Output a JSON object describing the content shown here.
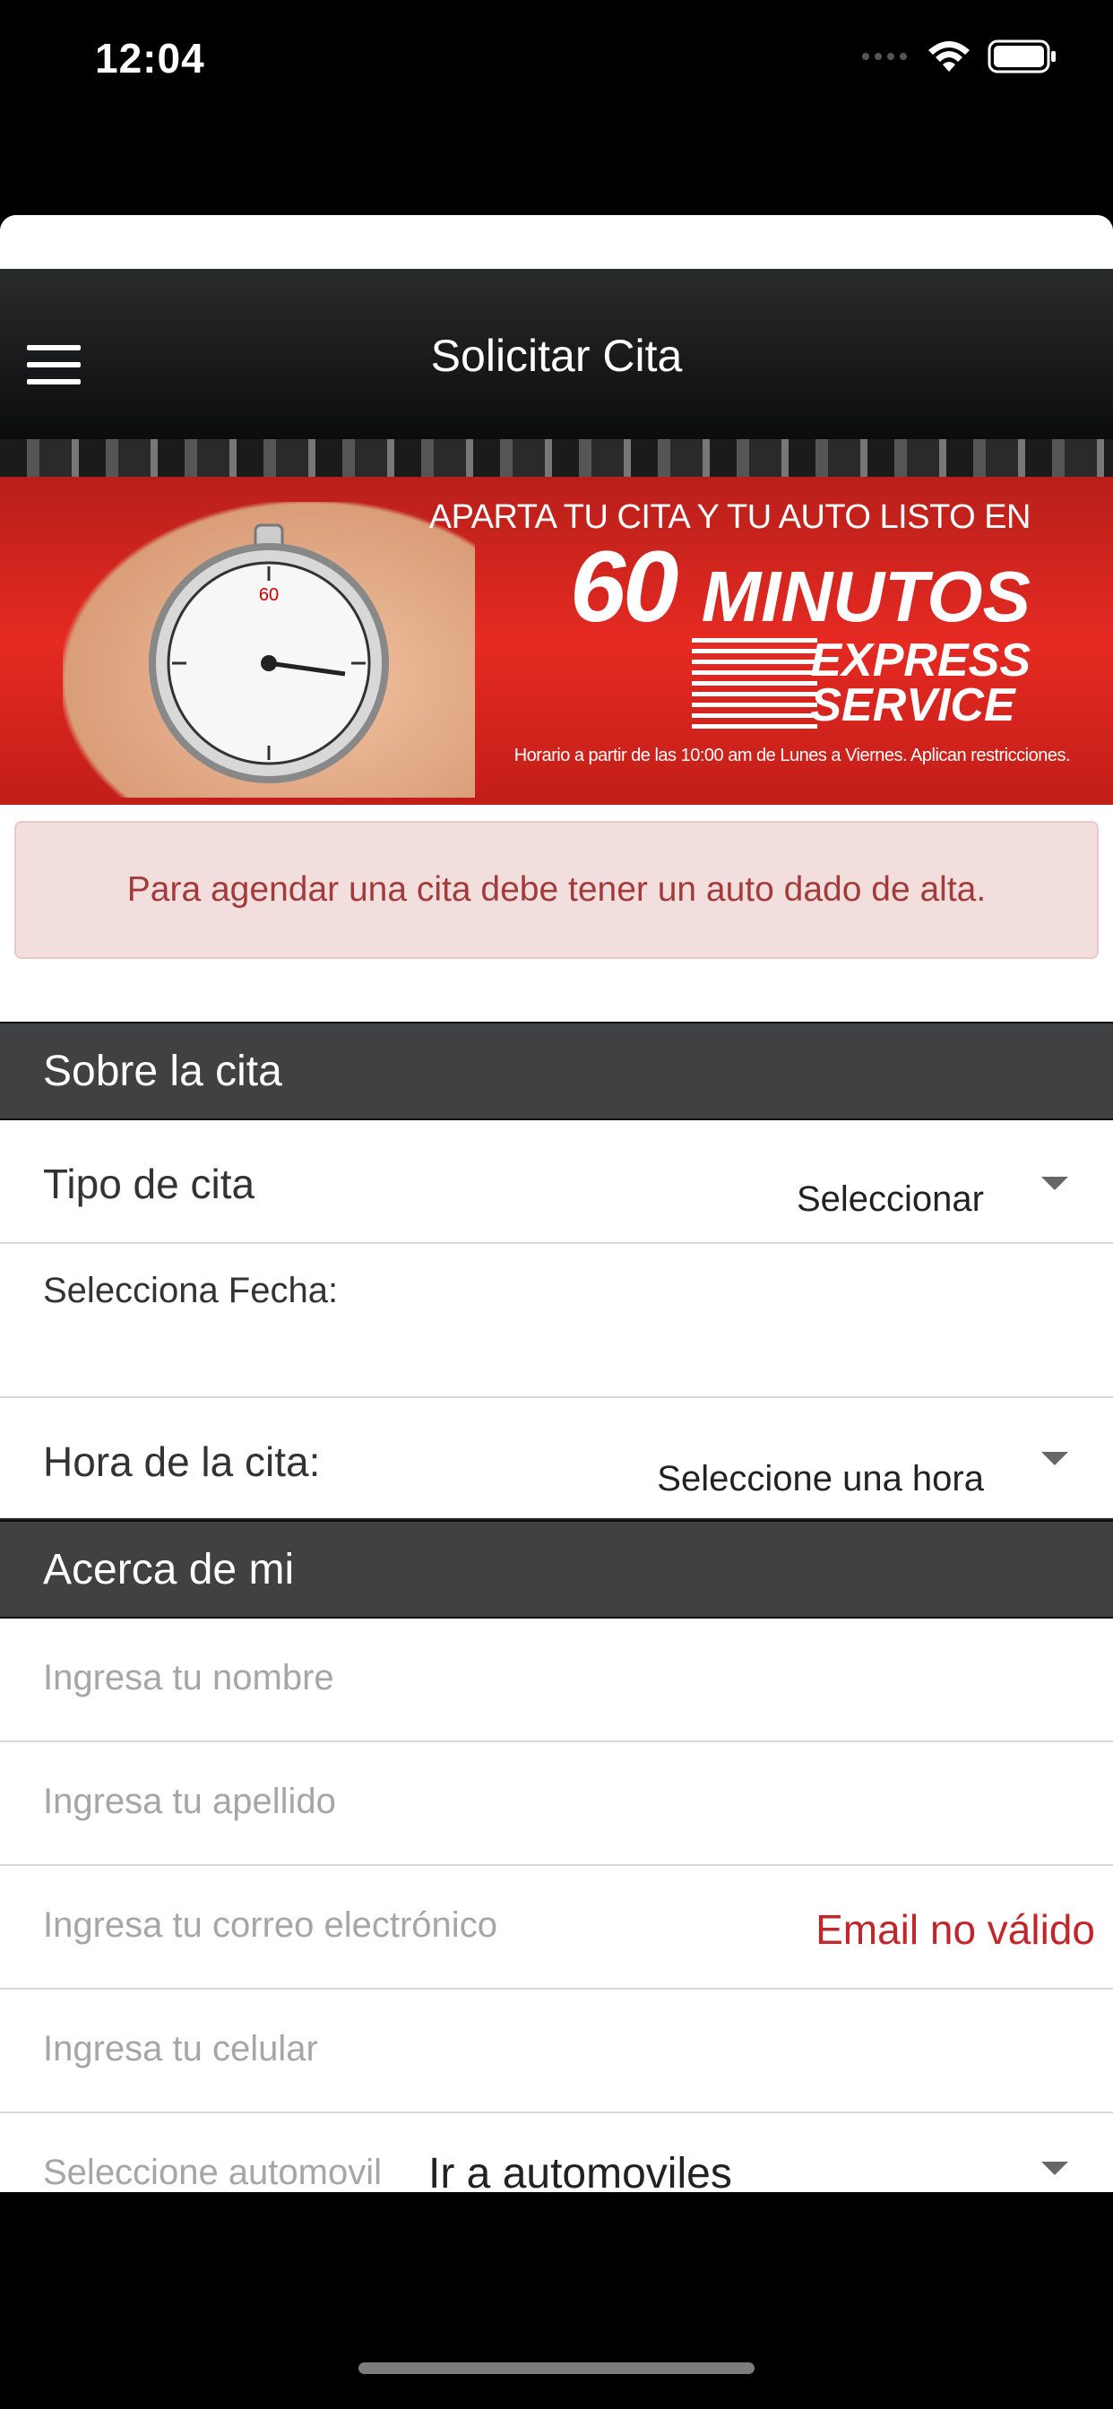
{
  "status_bar": {
    "time": "12:04"
  },
  "nav": {
    "title": "Solicitar Cita"
  },
  "banner": {
    "line1": "APARTA TU CITA Y TU AUTO LISTO EN",
    "number": "60",
    "minutes": "MINUTOS",
    "express_line1": "EXPRESS",
    "express_line2": "SERVICE",
    "note": "Horario a partir de las 10:00 am de Lunes a Viernes. Aplican restricciones."
  },
  "alert": {
    "text": "Para agendar una cita debe tener un auto dado de alta."
  },
  "section_cita": {
    "title": "Sobre la cita",
    "tipo_label": "Tipo de cita",
    "tipo_value": "Seleccionar",
    "fecha_label": "Selecciona Fecha:",
    "hora_label": "Hora de la cita:",
    "hora_value": "Seleccione una hora"
  },
  "section_mi": {
    "title": "Acerca de mi",
    "nombre_placeholder": "Ingresa tu nombre",
    "apellido_placeholder": "Ingresa tu apellido",
    "correo_placeholder": "Ingresa tu correo electrónico",
    "correo_error": "Email no válido",
    "celular_placeholder": "Ingresa tu celular",
    "auto_label": "Seleccione automovil",
    "auto_value": "Ir a automoviles"
  },
  "colors": {
    "accent_red": "#e52a22",
    "error_red": "#c0262a",
    "section_header": "#404142"
  }
}
